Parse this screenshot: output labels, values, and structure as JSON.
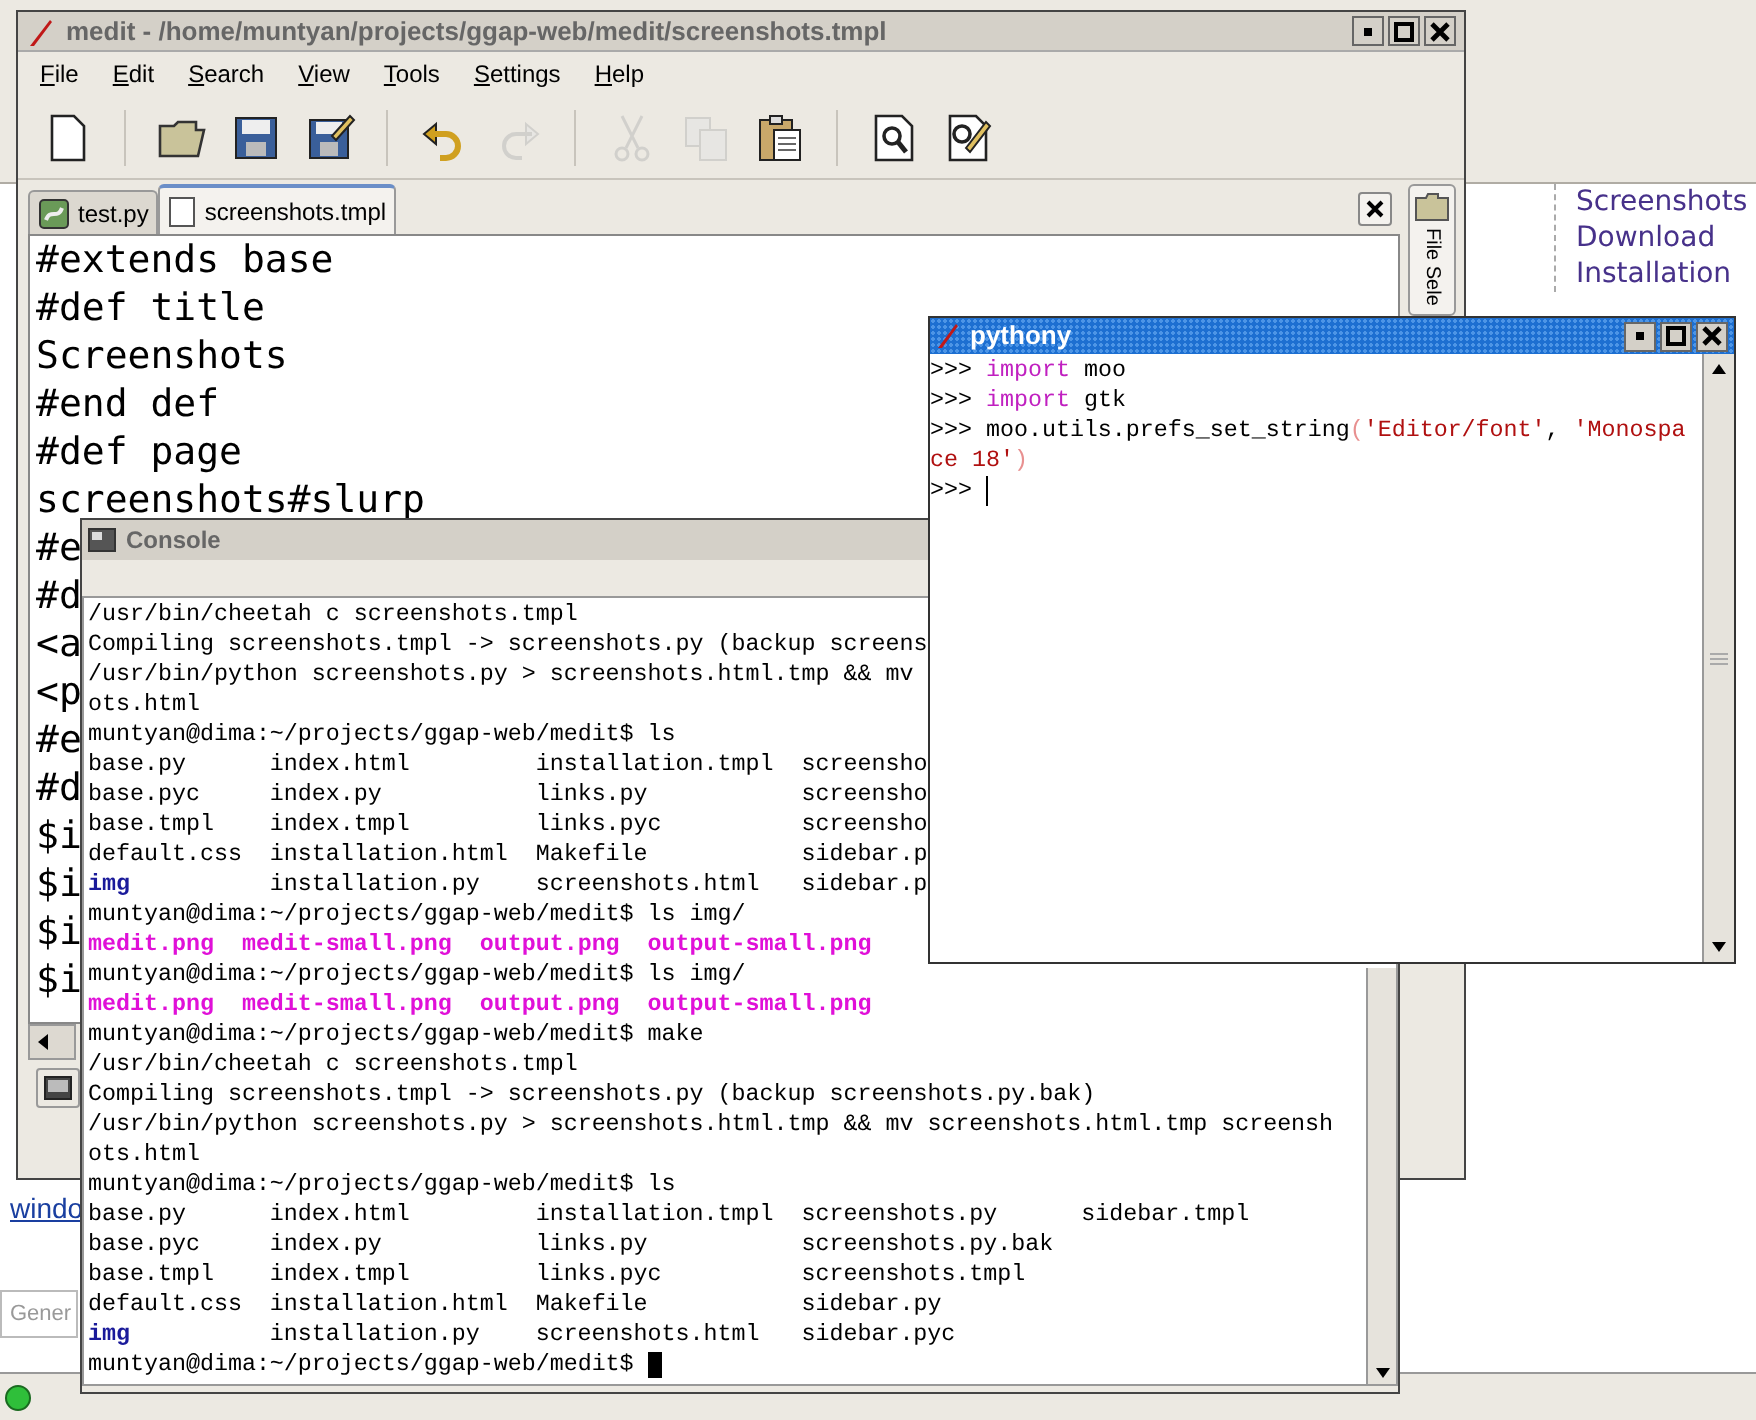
{
  "browser_window": {
    "links": [
      {
        "label": "Screenshots"
      },
      {
        "label": "Download"
      },
      {
        "label": "Installation"
      }
    ],
    "page_link": "windo",
    "search_field": {
      "value": "Gener"
    }
  },
  "editor_window": {
    "title": "medit - /home/muntyan/projects/ggap-web/medit/screenshots.tmpl",
    "menu": [
      "File",
      "Edit",
      "Search",
      "View",
      "Tools",
      "Settings",
      "Help"
    ],
    "toolbar": [
      {
        "kind": "new",
        "disabled": false
      },
      {
        "kind": "separator"
      },
      {
        "kind": "open",
        "disabled": false
      },
      {
        "kind": "save",
        "disabled": false
      },
      {
        "kind": "save_as",
        "disabled": false
      },
      {
        "kind": "separator"
      },
      {
        "kind": "undo",
        "disabled": false
      },
      {
        "kind": "redo",
        "disabled": true
      },
      {
        "kind": "separator"
      },
      {
        "kind": "cut",
        "disabled": true
      },
      {
        "kind": "copy",
        "disabled": true
      },
      {
        "kind": "paste",
        "disabled": false
      },
      {
        "kind": "separator"
      },
      {
        "kind": "find",
        "disabled": false
      },
      {
        "kind": "find_replace",
        "disabled": false
      }
    ],
    "tabs": [
      {
        "label": "test.py",
        "kind": "python",
        "selected": false
      },
      {
        "label": "screenshots.tmpl",
        "kind": "text",
        "selected": true
      }
    ],
    "side_panel_tab": "File Sele",
    "lines": [
      "#extends base",
      "#def title",
      "Screenshots",
      "#end def",
      "#def page",
      "screenshots#slurp",
      "#e",
      "#d",
      "<a",
      "<p",
      "#e",
      "#d",
      "$i",
      "$i",
      "$i",
      "$i"
    ]
  },
  "console_window": {
    "title": "Console",
    "lines": [
      [
        {
          "kind": "plain",
          "text": "/usr/bin/cheetah c screenshots.tmpl"
        }
      ],
      [
        {
          "kind": "plain",
          "text": "Compiling screenshots.tmpl -> screenshots.py (backup screens"
        }
      ],
      [
        {
          "kind": "plain",
          "text": "/usr/bin/python screenshots.py > screenshots.html.tmp && mv"
        }
      ],
      [
        {
          "kind": "plain",
          "text": "ots.html"
        }
      ],
      [
        {
          "kind": "plain",
          "text": "muntyan@dima:~/projects/ggap-web/medit$ ls"
        }
      ],
      [
        {
          "kind": "plain",
          "text": "base.py      index.html         installation.tmpl  screensho"
        }
      ],
      [
        {
          "kind": "plain",
          "text": "base.pyc     index.py           links.py           screensho"
        }
      ],
      [
        {
          "kind": "plain",
          "text": "base.tmpl    index.tmpl         links.pyc          screensho"
        }
      ],
      [
        {
          "kind": "plain",
          "text": "default.css  installation.html  Makefile           sidebar.p"
        }
      ],
      [
        {
          "kind": "directory",
          "text": "img"
        },
        {
          "kind": "plain",
          "text": "installation.py    screenshots.html   sidebar.p"
        }
      ],
      [
        {
          "kind": "plain",
          "text": "muntyan@dima:~/projects/ggap-web/medit$ ls img/"
        }
      ],
      [
        {
          "kind": "image",
          "text": "medit.png  medit-small.png  output.png  output-small.png"
        }
      ],
      [
        {
          "kind": "plain",
          "text": "muntyan@dima:~/projects/ggap-web/medit$ ls img/"
        }
      ],
      [
        {
          "kind": "image",
          "text": "medit.png  medit-small.png  output.png  output-small.png"
        }
      ],
      [
        {
          "kind": "plain",
          "text": "muntyan@dima:~/projects/ggap-web/medit$ make"
        }
      ],
      [
        {
          "kind": "plain",
          "text": "/usr/bin/cheetah c screenshots.tmpl"
        }
      ],
      [
        {
          "kind": "plain",
          "text": "Compiling screenshots.tmpl -> screenshots.py (backup screenshots.py.bak)"
        }
      ],
      [
        {
          "kind": "plain",
          "text": "/usr/bin/python screenshots.py > screenshots.html.tmp && mv screenshots.html.tmp screensh"
        }
      ],
      [
        {
          "kind": "plain",
          "text": "ots.html"
        }
      ],
      [
        {
          "kind": "plain",
          "text": "muntyan@dima:~/projects/ggap-web/medit$ ls"
        }
      ],
      [
        {
          "kind": "plain",
          "text": "base.py      index.html         installation.tmpl  screenshots.py      sidebar.tmpl"
        }
      ],
      [
        {
          "kind": "plain",
          "text": "base.pyc     index.py           links.py           screenshots.py.bak"
        }
      ],
      [
        {
          "kind": "plain",
          "text": "base.tmpl    index.tmpl         links.pyc          screenshots.tmpl"
        }
      ],
      [
        {
          "kind": "plain",
          "text": "default.css  installation.html  Makefile           sidebar.py"
        }
      ],
      [
        {
          "kind": "directory",
          "text": "img"
        },
        {
          "kind": "plain",
          "text": "installation.py    screenshots.html   sidebar.pyc"
        }
      ],
      [
        {
          "kind": "plain",
          "text": "muntyan@dima:~/projects/ggap-web/medit$"
        }
      ]
    ]
  },
  "python_window": {
    "title": "pythony",
    "lines": [
      [
        {
          "kind": "prompt",
          "text": ">>>"
        },
        {
          "kind": "keyword",
          "text": "import"
        },
        {
          "kind": "plain",
          "text": " moo"
        }
      ],
      [
        {
          "kind": "prompt",
          "text": ">>>"
        },
        {
          "kind": "keyword",
          "text": "import"
        },
        {
          "kind": "plain",
          "text": " gtk"
        }
      ],
      [
        {
          "kind": "prompt",
          "text": ">>>"
        },
        {
          "kind": "plain",
          "text": "moo.utils.prefs_set_string"
        },
        {
          "kind": "paren",
          "text": "("
        },
        {
          "kind": "string",
          "text": "'Editor/font'"
        },
        {
          "kind": "plain",
          "text": ", "
        },
        {
          "kind": "string",
          "text": "'Monospa"
        }
      ],
      [
        {
          "kind": "string",
          "text": "ce 18'"
        },
        {
          "kind": "paren",
          "text": ")"
        }
      ],
      [
        {
          "kind": "prompt",
          "text": ">>>"
        }
      ]
    ]
  }
}
